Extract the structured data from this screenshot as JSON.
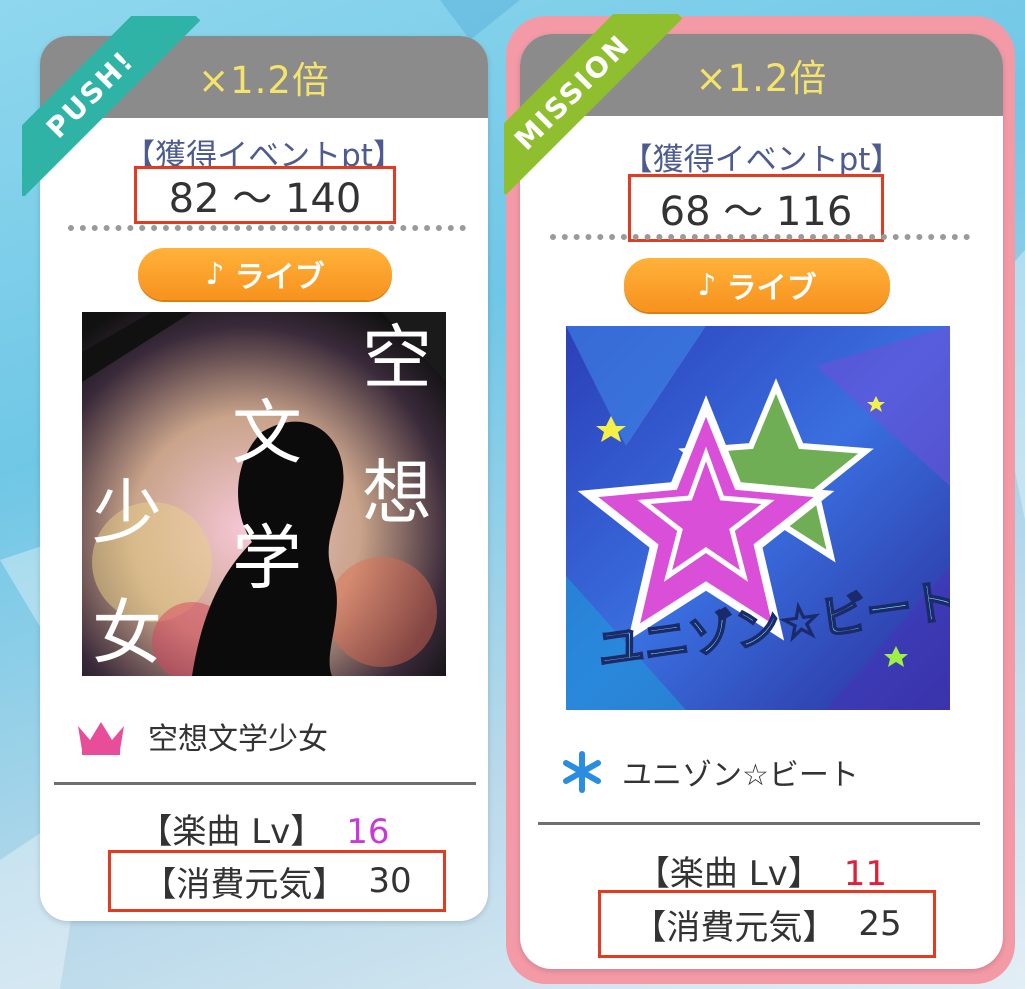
{
  "colors": {
    "push_ribbon": "#2eb3a6",
    "mission_ribbon": "#8fbf2f",
    "multiplier_text": "#f5e46a",
    "highlight_box": "#e33b1f",
    "lv_purple": "#c83ad7",
    "lv_red": "#e0203a",
    "crown": "#e84d9a",
    "snow": "#2a8de0",
    "live_button": "#f7921e"
  },
  "cards": [
    {
      "ribbon": "PUSH!",
      "multiplier": "×1.2倍",
      "pt_label": "【獲得イベントpt】",
      "pt_range": "82 ～ 140",
      "live_label": "ライブ",
      "jacket_chars": [
        "空",
        "想",
        "文",
        "学",
        "少",
        "女"
      ],
      "song_icon": "crown-icon",
      "song_title": "空想文学少女",
      "lv_label": "【楽曲 Lv】",
      "lv_value": "16",
      "stamina_label": "【消費元気】",
      "stamina_value": "30"
    },
    {
      "ribbon": "MISSION",
      "multiplier": "×1.2倍",
      "pt_label": "【獲得イベントpt】",
      "pt_range": "68 ～ 116",
      "live_label": "ライブ",
      "jacket_logo": "ユニゾン☆ビート",
      "song_icon": "snowflake-icon",
      "song_title": "ユニゾン☆ビート",
      "lv_label": "【楽曲 Lv】",
      "lv_value": "11",
      "stamina_label": "【消費元気】",
      "stamina_value": "25"
    }
  ]
}
